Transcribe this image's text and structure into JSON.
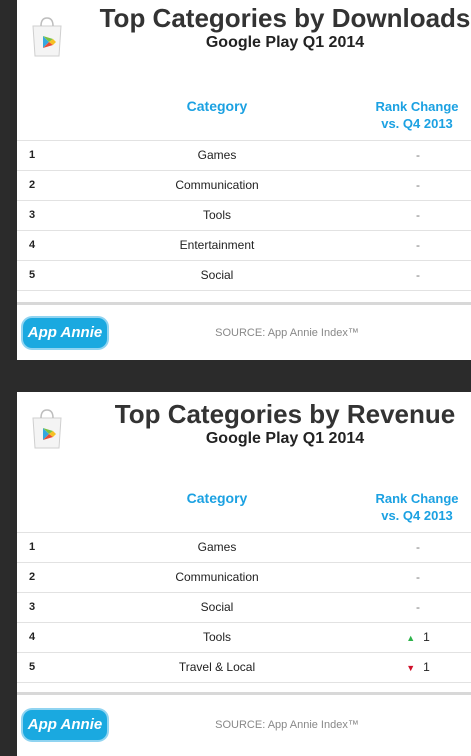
{
  "sections": [
    {
      "title": "Top Categories by Downloads",
      "subtitle": "Google Play Q1 2014",
      "header_category": "Category",
      "header_rank_line1": "Rank Change",
      "header_rank_line2": "vs. Q4 2013",
      "rows": [
        {
          "rank": "1",
          "name": "Games",
          "change": "-",
          "dir": "none"
        },
        {
          "rank": "2",
          "name": "Communication",
          "change": "-",
          "dir": "none"
        },
        {
          "rank": "3",
          "name": "Tools",
          "change": "-",
          "dir": "none"
        },
        {
          "rank": "4",
          "name": "Entertainment",
          "change": "-",
          "dir": "none"
        },
        {
          "rank": "5",
          "name": "Social",
          "change": "-",
          "dir": "none"
        }
      ],
      "badge": "App Annie",
      "source": "SOURCE: App Annie Index™"
    },
    {
      "title": "Top Categories by Revenue",
      "subtitle": "Google Play Q1 2014",
      "header_category": "Category",
      "header_rank_line1": "Rank Change",
      "header_rank_line2": "vs. Q4 2013",
      "rows": [
        {
          "rank": "1",
          "name": "Games",
          "change": "-",
          "dir": "none"
        },
        {
          "rank": "2",
          "name": "Communication",
          "change": "-",
          "dir": "none"
        },
        {
          "rank": "3",
          "name": "Social",
          "change": "-",
          "dir": "none"
        },
        {
          "rank": "4",
          "name": "Tools",
          "change": "1",
          "dir": "up"
        },
        {
          "rank": "5",
          "name": "Travel & Local",
          "change": "1",
          "dir": "down"
        }
      ],
      "badge": "App Annie",
      "source": "SOURCE: App Annie Index™"
    }
  ],
  "colors": {
    "accent": "#1ba1e2",
    "up": "#2db34a",
    "down": "#d0112b",
    "badge": "#1aa9e0"
  },
  "icons": {
    "logo": "google-play-store-bag-icon",
    "up": "triangle-up-icon",
    "down": "triangle-down-icon"
  }
}
